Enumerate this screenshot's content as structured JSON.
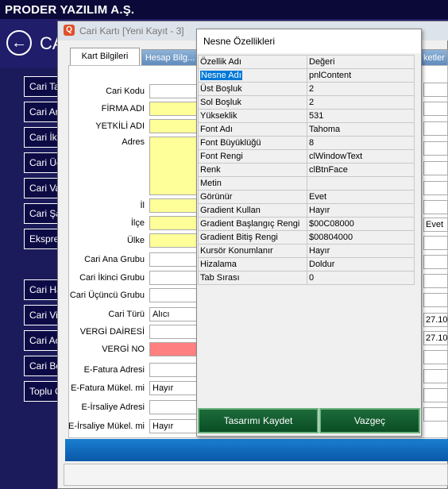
{
  "app": {
    "title": "PRODER YAZILIM A.Ş.",
    "page_title": "CA"
  },
  "menu": [
    "Cari Ta",
    "Cari Ar",
    "Cari İki",
    "Cari Üç",
    "Cari Va",
    "Cari Şa",
    "Ekspre",
    "Cari Ha",
    "Cari Vir",
    "Cari Aç",
    "Cari Bo",
    "Toplu C"
  ],
  "cari_window": {
    "title": "Cari Kartı [Yeni Kayıt - 3]",
    "tabs": [
      "Kart Bilgileri",
      "Hesap Bilg...",
      "ketler"
    ],
    "fields": [
      {
        "label": "Cari Kodu",
        "value": ""
      },
      {
        "label": "FİRMA ADI",
        "value": ""
      },
      {
        "label": "YETKİLİ ADI",
        "value": ""
      },
      {
        "label": "Adres",
        "value": ""
      },
      {
        "label": "İl",
        "value": ""
      },
      {
        "label": "İlçe",
        "value": ""
      },
      {
        "label": "Ülke",
        "value": ""
      },
      {
        "label": "Cari Ana Grubu",
        "value": ""
      },
      {
        "label": "Cari İkinci Grubu",
        "value": ""
      },
      {
        "label": "Cari Üçüncü Grubu",
        "value": ""
      },
      {
        "label": "Cari Türü",
        "value": "Alıcı"
      },
      {
        "label": "VERGİ DAİRESİ",
        "value": ""
      },
      {
        "label": "VERGİ NO",
        "value": ""
      },
      {
        "label": "E-Fatura Adresi",
        "value": ""
      },
      {
        "label": "E-Fatura Mükel. mi",
        "value": "Hayır"
      },
      {
        "label": "E-İrsaliye Adresi",
        "value": ""
      },
      {
        "label": "E-İrsaliye Mükel. mi",
        "value": "Hayır"
      }
    ],
    "right_values": {
      "evet": "Evet",
      "date1": "27.10",
      "date2": "27.10"
    }
  },
  "dialog": {
    "title": "Nesne Özellikleri",
    "headers": [
      "Özellik Adı",
      "Değeri"
    ],
    "rows": [
      [
        "Nesne Adı",
        "pnlContent"
      ],
      [
        "Üst Boşluk",
        "2"
      ],
      [
        "Sol Boşluk",
        "2"
      ],
      [
        "Yükseklik",
        "531"
      ],
      [
        "Font Adı",
        "Tahoma"
      ],
      [
        "Font Büyüklüğü",
        "8"
      ],
      [
        "Font Rengi",
        "clWindowText"
      ],
      [
        "Renk",
        "clBtnFace"
      ],
      [
        "Metin",
        ""
      ],
      [
        "Görünür",
        "Evet"
      ],
      [
        "Gradient Kullan",
        "Hayır"
      ],
      [
        "Gradient Başlangıç Rengi",
        "$00C08000"
      ],
      [
        "Gradient Bitiş Rengi",
        "$00804000"
      ],
      [
        "Kursör Konumlanır",
        "Hayır"
      ],
      [
        "Hizalama",
        "Doldur"
      ],
      [
        "Tab Sırası",
        "0"
      ]
    ],
    "save_label": "Tasarımı Kaydet",
    "cancel_label": "Vazgeç"
  }
}
